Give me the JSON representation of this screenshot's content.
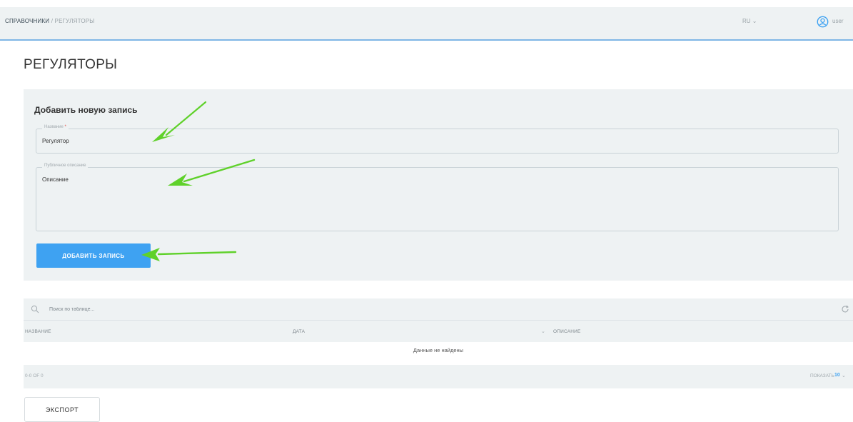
{
  "header": {
    "breadcrumb_root": "СПРАВОЧНИКИ",
    "breadcrumb_separator": " / ",
    "breadcrumb_current": "РЕГУЛЯТОРЫ",
    "language": "RU",
    "language_chevron": "⌄",
    "user_name": "user",
    "user_icon": "user-circle-icon"
  },
  "page": {
    "title": "РЕГУЛЯТОРЫ"
  },
  "form": {
    "title": "Добавить новую запись",
    "name_label": "Название",
    "name_required_mark": "*",
    "name_value": "Регулятор",
    "description_label": "Публичное описание",
    "description_value": "Описание",
    "submit_label": "ДОБАВИТЬ ЗАПИСЬ"
  },
  "annotations": {
    "arrow_color": "#5fd12a"
  },
  "table": {
    "search_placeholder": "Поиск по таблице...",
    "columns": [
      "НАЗВАНИЕ",
      "ДАТА",
      "ОПИСАНИЕ"
    ],
    "sort_indicator": "⌄",
    "empty_text": "Данные не найдены",
    "range_text": "0-0 OF 0",
    "show_label": "ПОКАЗАТЬ",
    "page_size": "10",
    "page_size_chevron": "⌄"
  },
  "export": {
    "label": "ЭКСПОРТ"
  },
  "colors": {
    "accent": "#3ea2f2",
    "panel_bg": "#eef2f3",
    "header_border": "#7fb6e6"
  }
}
